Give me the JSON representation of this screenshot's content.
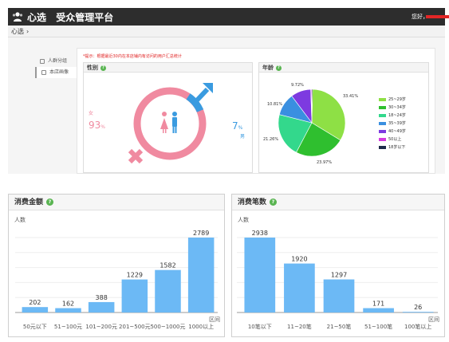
{
  "header": {
    "logo_icon": "users-icon",
    "brand_name": "心选",
    "platform_title": "受众管理平台",
    "welcome_text": "您好，"
  },
  "breadcrumb": {
    "root": "心选",
    "chevron": "›"
  },
  "sidebar": {
    "items": [
      {
        "label": "人群分组",
        "icon": "group-icon",
        "active": false
      },
      {
        "label": "本店画像",
        "icon": "portrait-icon",
        "active": true
      }
    ]
  },
  "tip": "*提示：根据最近30内在本店铺内有访问的用户汇总统计",
  "gender_card": {
    "title": "性别",
    "female_label": "女",
    "female_value": "93",
    "female_unit": "%",
    "male_value": "7",
    "male_unit": "%",
    "male_label": "男",
    "female_color": "#f08aa0",
    "male_color": "#3a9be0"
  },
  "age_card": {
    "title": "年龄",
    "chart_data": {
      "type": "pie",
      "slices": [
        {
          "label": "25~29岁",
          "value": 33.41,
          "color": "#8ee045"
        },
        {
          "label": "30~34岁",
          "value": 23.97,
          "color": "#2fbf2f"
        },
        {
          "label": "18~24岁",
          "value": 21.26,
          "color": "#33d88c"
        },
        {
          "label": "35~39岁",
          "value": 10.81,
          "color": "#3a8fe0"
        },
        {
          "label": "40~49岁",
          "value": 9.72,
          "color": "#7d3ae0"
        },
        {
          "label": "50以上",
          "value": 0.4,
          "color": "#d53ae0"
        },
        {
          "label": "18岁以下",
          "value": 0.43,
          "color": "#1e2a4a"
        }
      ],
      "shown_labels": [
        "33.41%",
        "23.97%",
        "21.26%",
        "10.81%",
        "9.72%"
      ]
    }
  },
  "amount_card": {
    "title": "消费金额",
    "y_label": "人数",
    "x_unit": "区间",
    "chart_data": {
      "type": "bar",
      "categories": [
        "50元以下",
        "51~100元",
        "101~200元",
        "201~500元",
        "500~1000元",
        "1000以上"
      ],
      "values": [
        202,
        162,
        388,
        1229,
        1582,
        2789
      ],
      "ylim": [
        0,
        2789
      ],
      "bar_color": "#6cb9f5"
    }
  },
  "count_card": {
    "title": "消费笔数",
    "y_label": "人数",
    "x_unit": "区间",
    "chart_data": {
      "type": "bar",
      "categories": [
        "10笔以下",
        "11~20笔",
        "21~50笔",
        "51~100笔",
        "100笔以上"
      ],
      "values": [
        2938,
        1920,
        1297,
        171,
        26
      ],
      "ylim": [
        0,
        2938
      ],
      "bar_color": "#6cb9f5"
    }
  }
}
